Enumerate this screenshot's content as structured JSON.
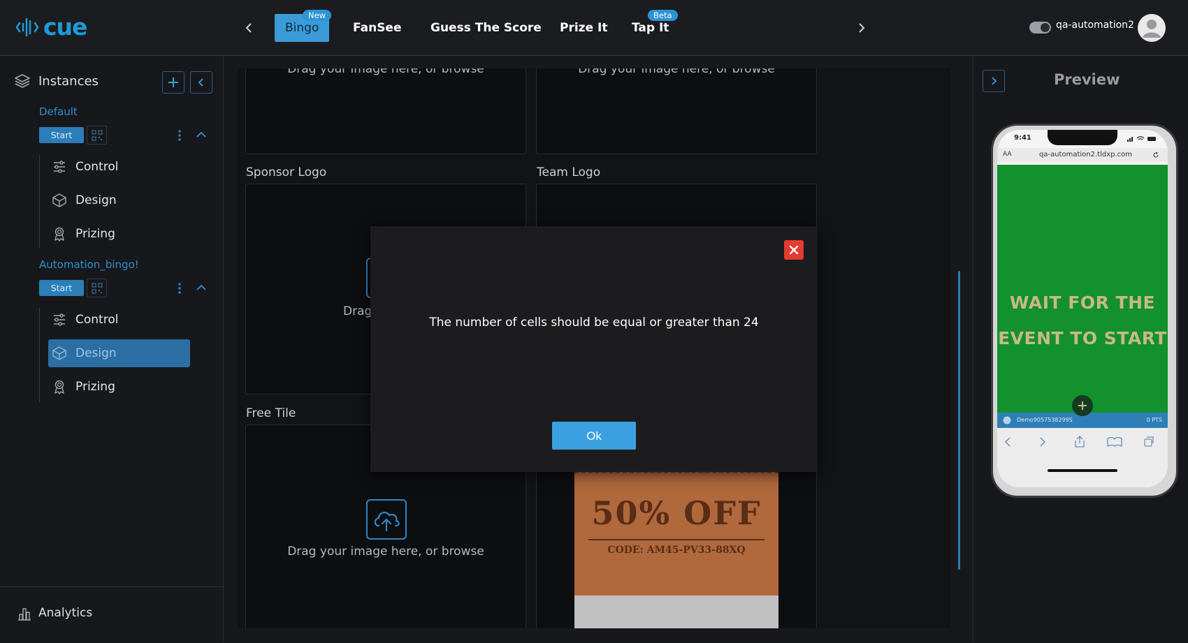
{
  "brand": {
    "name": "cue",
    "color": "#1e9bd7"
  },
  "topnav": {
    "tabs": [
      {
        "label": "Bingo",
        "badge": "New",
        "active": true
      },
      {
        "label": "FanSee"
      },
      {
        "label": "Guess The Score"
      },
      {
        "label": "Prize It"
      },
      {
        "label": "Tap It",
        "badge": "Beta"
      }
    ],
    "username": "qa-automation2"
  },
  "sidebar": {
    "title": "Instances",
    "groups": [
      {
        "name": "Default",
        "start_label": "Start",
        "items": [
          {
            "label": "Control",
            "icon": "sliders-icon"
          },
          {
            "label": "Design",
            "icon": "cube-icon"
          },
          {
            "label": "Prizing",
            "icon": "award-icon"
          }
        ]
      },
      {
        "name": "Automation_bingo!",
        "start_label": "Start",
        "items": [
          {
            "label": "Control",
            "icon": "sliders-icon"
          },
          {
            "label": "Design",
            "icon": "cube-icon",
            "active": true
          },
          {
            "label": "Prizing",
            "icon": "award-icon"
          }
        ]
      }
    ],
    "analytics_label": "Analytics"
  },
  "content": {
    "drop_text": "Drag your image here, or browse",
    "drop_text_partial": "Drag your ima",
    "labels": {
      "sponsor_logo": "Sponsor Logo",
      "team_logo": "Team Logo",
      "free_tile": "Free Tile"
    },
    "coupon": {
      "big": "50% OFF",
      "code": "CODE: AM45-PV33-88XQ"
    }
  },
  "modal": {
    "message": "The number of cells should be equal or greater than 24",
    "ok_label": "Ok",
    "close_color": "#e23b32"
  },
  "preview": {
    "title": "Preview",
    "status_time": "9:41",
    "url_aa": "AA",
    "url": "qa-automation2.tldxp.com",
    "line1": "WAIT FOR THE",
    "line2": "EVENT TO START",
    "strip_left": "Demo9057538299S",
    "strip_right": "0 PTS",
    "green": "#12912d"
  }
}
